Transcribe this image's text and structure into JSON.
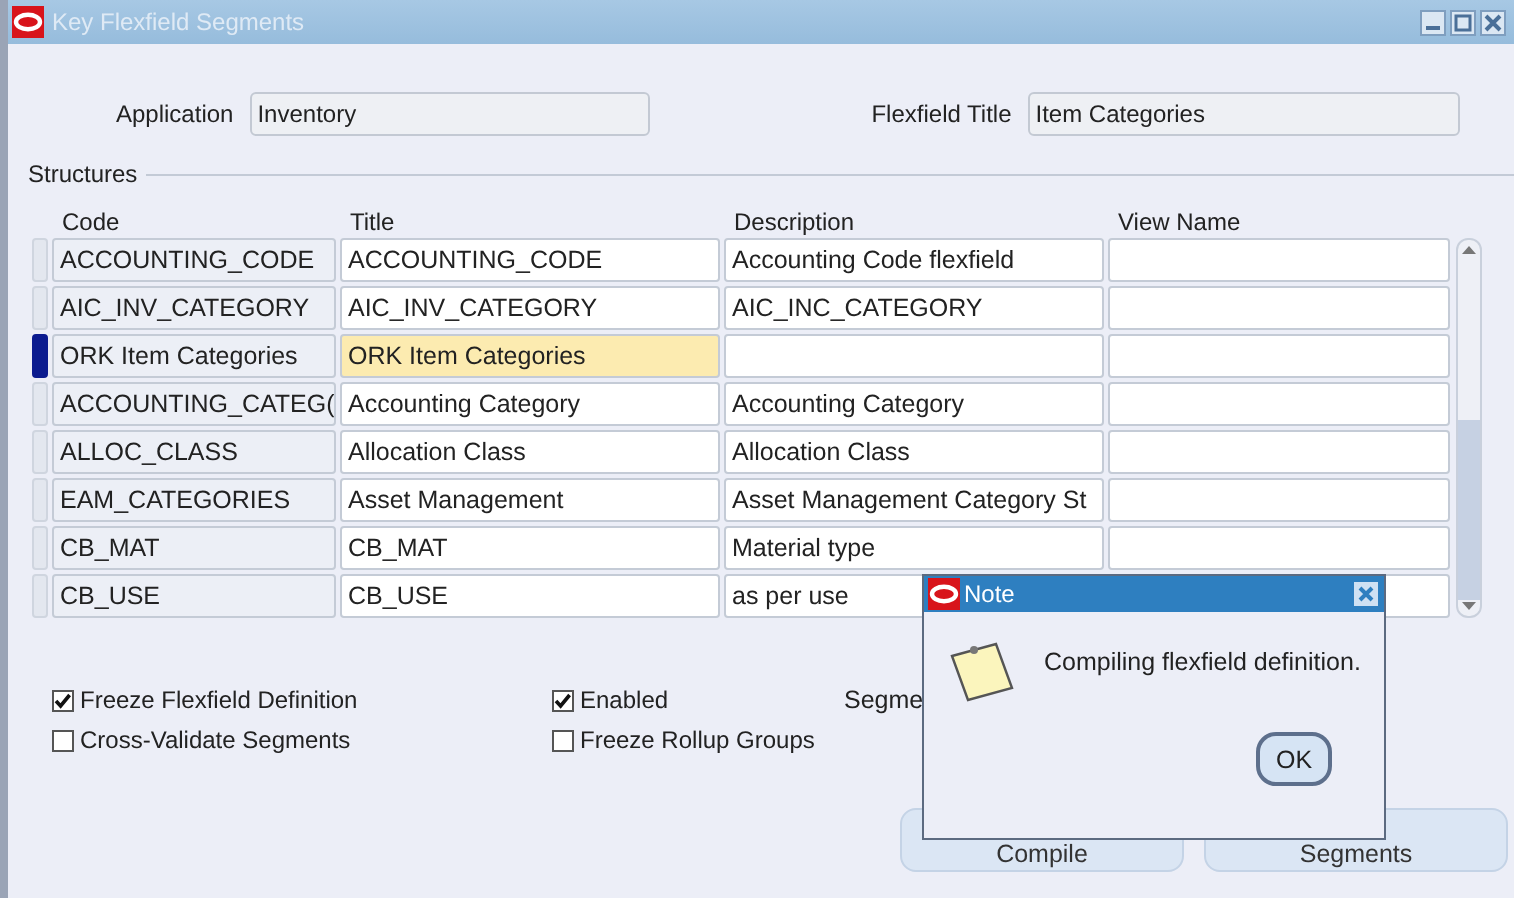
{
  "window": {
    "title": "Key Flexfield Segments"
  },
  "header": {
    "application_label": "Application",
    "application": "Inventory",
    "flexfield_title_label": "Flexfield Title",
    "flexfield_title": "Item Categories"
  },
  "structures": {
    "title": "Structures",
    "columns": [
      "Code",
      "Title",
      "Description",
      "View Name"
    ],
    "rows": [
      {
        "code": "ACCOUNTING_CODE",
        "title": "ACCOUNTING_CODE",
        "description": "Accounting Code flexfield",
        "selected": false
      },
      {
        "code": "AIC_INV_CATEGORY",
        "title": "AIC_INV_CATEGORY",
        "description": "AIC_INC_CATEGORY",
        "selected": false
      },
      {
        "code": "ORK Item Categories",
        "title": "ORK Item Categories",
        "description": "",
        "selected": true
      },
      {
        "code": "ACCOUNTING_CATEG(",
        "title": "Accounting Category",
        "description": "Accounting Category",
        "selected": false
      },
      {
        "code": "ALLOC_CLASS",
        "title": "Allocation Class",
        "description": "Allocation Class",
        "selected": false
      },
      {
        "code": "EAM_CATEGORIES",
        "title": "Asset Management",
        "description": "Asset Management Category St",
        "selected": false
      },
      {
        "code": "CB_MAT",
        "title": "CB_MAT",
        "description": "Material type",
        "selected": false
      },
      {
        "code": "CB_USE",
        "title": "CB_USE",
        "description": "as per use",
        "selected": false
      }
    ]
  },
  "options": [
    {
      "label": "Freeze Flexfield Definition",
      "checked": true
    },
    {
      "label": "Enabled",
      "checked": true
    },
    {
      "label": "Cross-Validate Segments",
      "checked": false
    },
    {
      "label": "Freeze Rollup Groups",
      "checked": false
    }
  ],
  "segment_label": "Segme",
  "buttons": [
    "Compile",
    "Segments"
  ],
  "dialog": {
    "title": "Note",
    "message": "Compiling flexfield definition.",
    "button": "OK"
  }
}
